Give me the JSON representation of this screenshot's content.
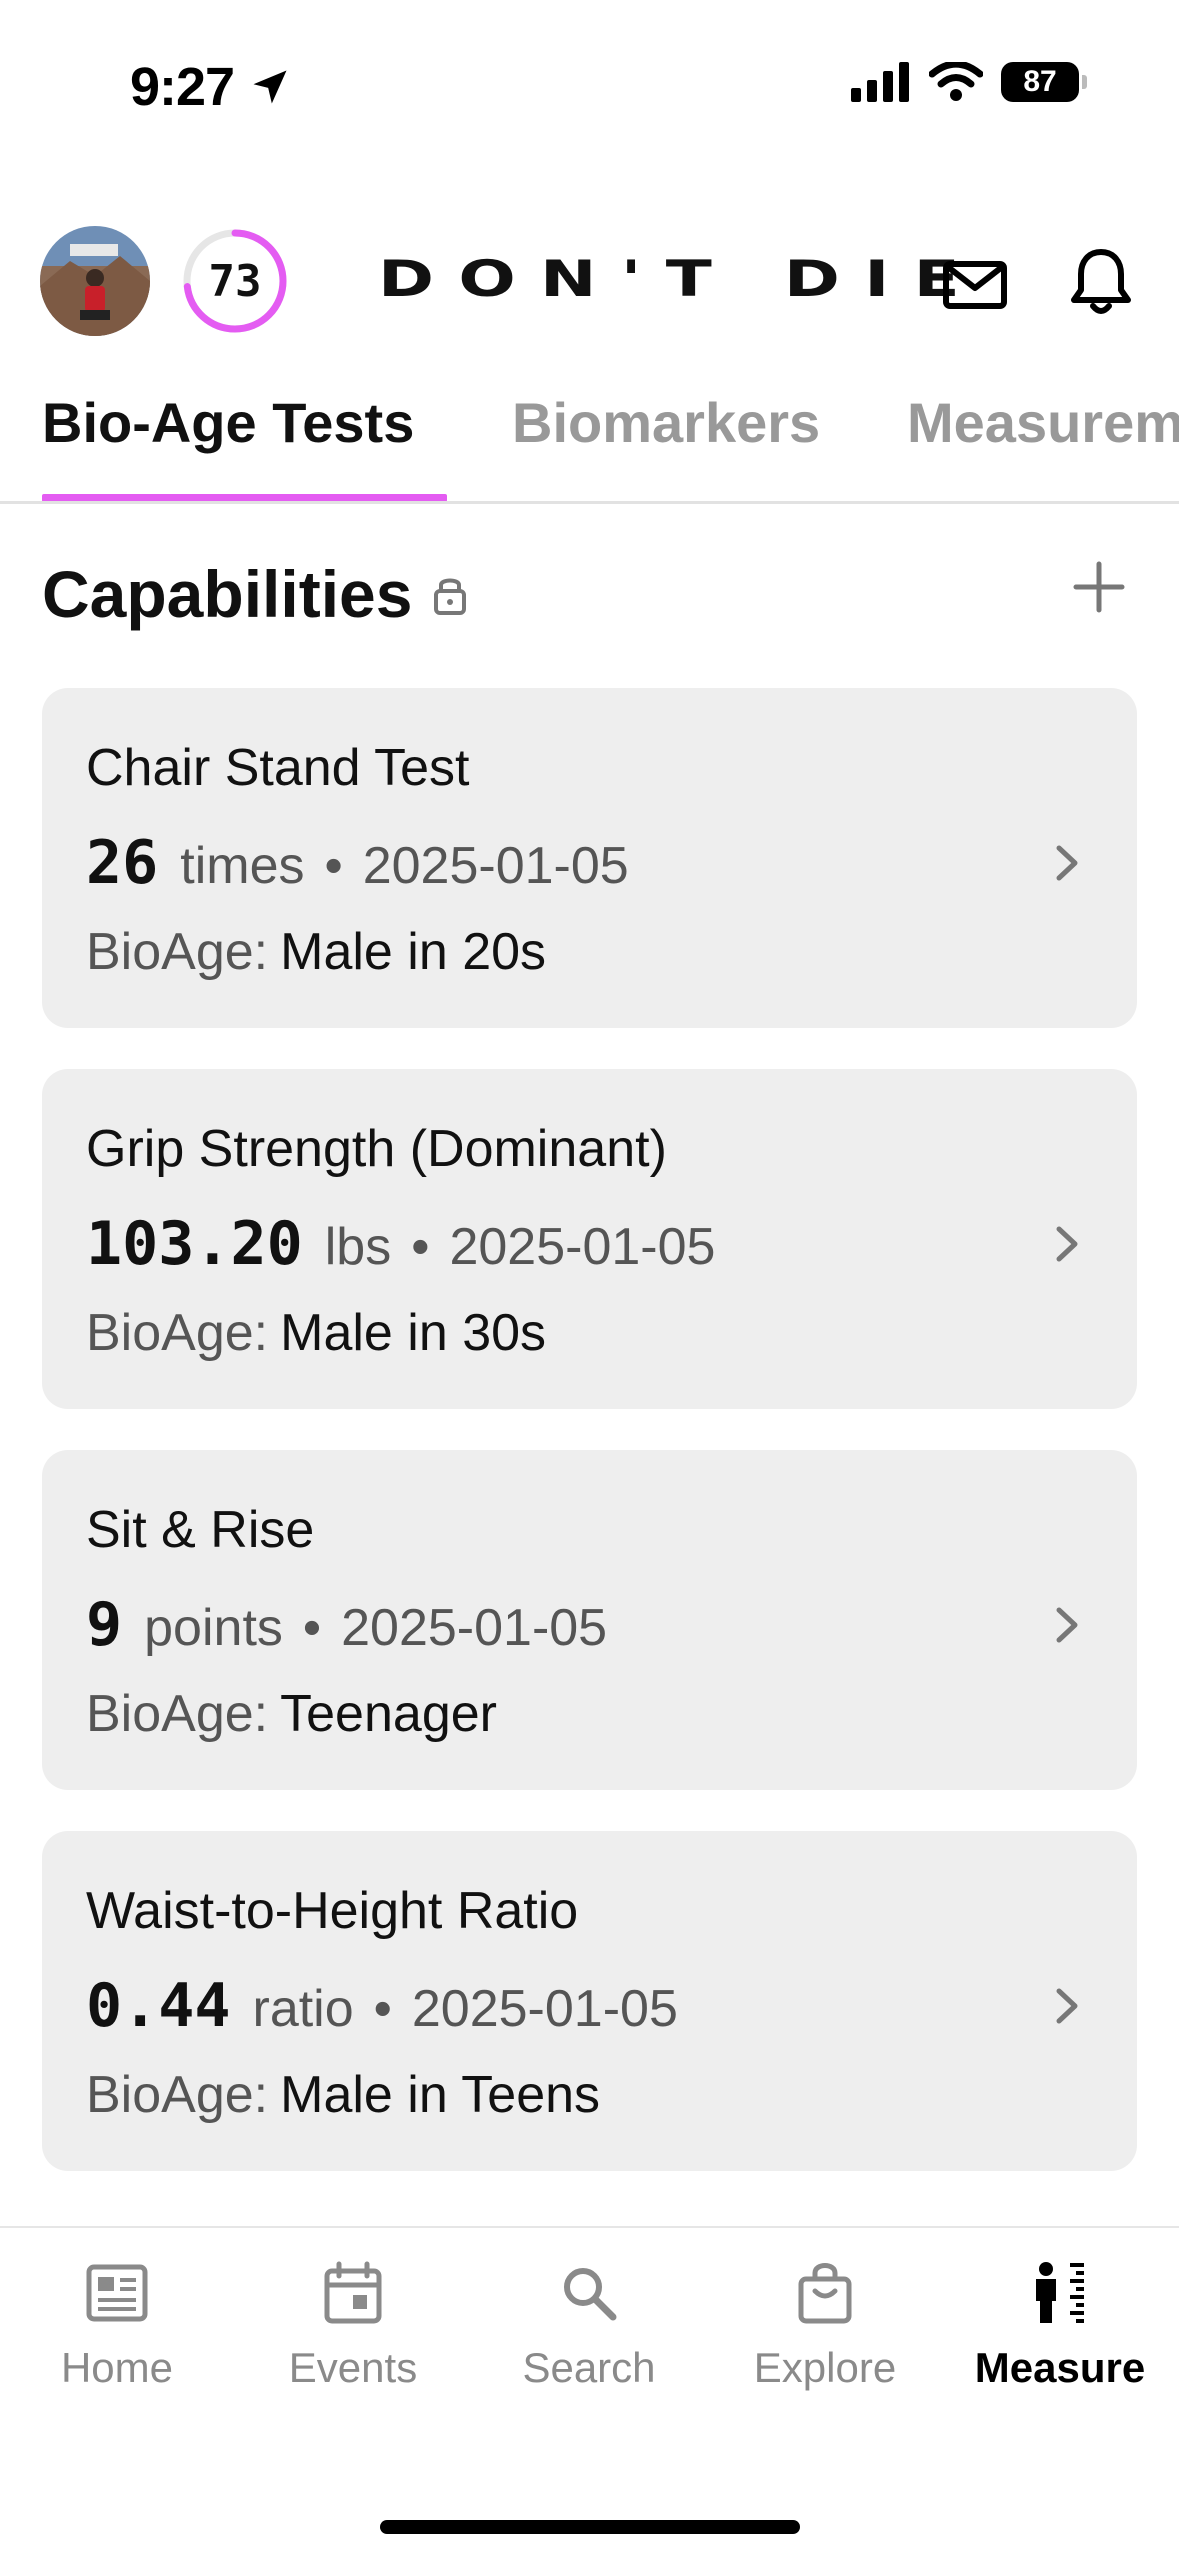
{
  "status_bar": {
    "time": "9:27",
    "battery": "87"
  },
  "header": {
    "score": "73",
    "brand": "DON'T DIE"
  },
  "tabs": [
    {
      "label": "Bio-Age Tests"
    },
    {
      "label": "Biomarkers"
    },
    {
      "label": "Measurements"
    }
  ],
  "section": {
    "title": "Capabilities"
  },
  "cards": [
    {
      "title": "Chair Stand Test",
      "value": "26",
      "unit": "times",
      "separator": "•",
      "date": "2025-01-05",
      "bio_label": "BioAge:",
      "bio_value": "Male in 20s"
    },
    {
      "title": "Grip Strength (Dominant)",
      "value": "103.20",
      "unit": "lbs",
      "separator": "•",
      "date": "2025-01-05",
      "bio_label": "BioAge:",
      "bio_value": "Male in 30s"
    },
    {
      "title": "Sit & Rise",
      "value": "9",
      "unit": "points",
      "separator": "•",
      "date": "2025-01-05",
      "bio_label": "BioAge:",
      "bio_value": "Teenager"
    },
    {
      "title": "Waist-to-Height Ratio",
      "value": "0.44",
      "unit": "ratio",
      "separator": "•",
      "date": "2025-01-05",
      "bio_label": "BioAge:",
      "bio_value": "Male in Teens"
    }
  ],
  "nav": [
    {
      "label": "Home",
      "icon": "home-icon"
    },
    {
      "label": "Events",
      "icon": "calendar-icon"
    },
    {
      "label": "Search",
      "icon": "search-icon"
    },
    {
      "label": "Explore",
      "icon": "bag-icon"
    },
    {
      "label": "Measure",
      "icon": "measure-icon"
    }
  ],
  "colors": {
    "accent": "#e45cf2",
    "card_bg": "#eeeeee",
    "inactive": "#8a8a8a"
  }
}
